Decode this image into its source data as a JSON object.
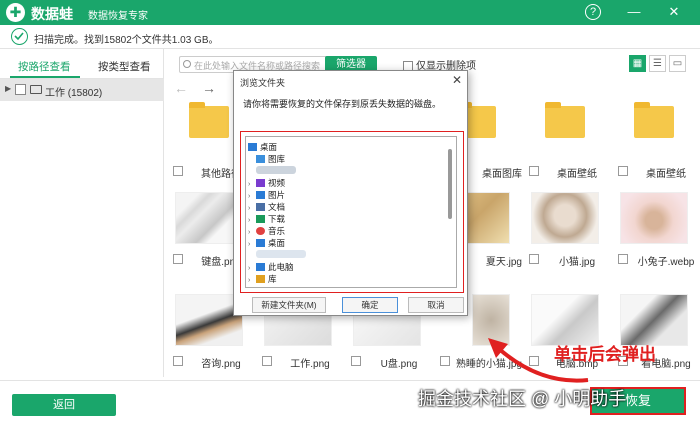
{
  "app": {
    "name": "数据蛙",
    "subtitle": "数据恢复专家"
  },
  "titlebar": {
    "help": "?",
    "minimize": "—",
    "close": "✕"
  },
  "status": {
    "text": "扫描完成。找到15802个文件共1.03 GB。"
  },
  "sidebar": {
    "tabs": [
      {
        "label": "按路径查看"
      },
      {
        "label": "按类型查看"
      }
    ],
    "tree": [
      {
        "label": "工作 (15802)"
      }
    ]
  },
  "toolbar": {
    "search_placeholder": "在此处输入文件名称或路径搜索",
    "filter_label": "筛选器",
    "only_deleted_label": "仅显示删除项"
  },
  "grid": {
    "items": [
      {
        "name": "",
        "kind": "folder"
      },
      {
        "name": "",
        "kind": "folder"
      },
      {
        "name": "",
        "kind": "folder"
      },
      {
        "name": "",
        "kind": "folder"
      },
      {
        "name": "",
        "kind": "folder"
      },
      {
        "name": "",
        "kind": "folder"
      },
      {
        "name": "其他路径",
        "kind": "label"
      },
      {
        "name": "",
        "kind": "label"
      },
      {
        "name": "",
        "kind": "label"
      },
      {
        "name": "桌面图库",
        "kind": "label"
      },
      {
        "name": "桌面壁纸",
        "kind": "label"
      },
      {
        "name": "桌面壁纸",
        "kind": "label"
      },
      {
        "name": "键盘.png",
        "kind": "photo"
      },
      {
        "name": "",
        "kind": "photo"
      },
      {
        "name": "",
        "kind": "photo"
      },
      {
        "name": "夏天.jpg",
        "kind": "photo"
      },
      {
        "name": "小猫.jpg",
        "kind": "photo"
      },
      {
        "name": "小兔子.webp",
        "kind": "photo"
      },
      {
        "name": "咨询.png",
        "kind": "photo"
      },
      {
        "name": "工作.png",
        "kind": "photo"
      },
      {
        "name": "U盘.png",
        "kind": "photo"
      },
      {
        "name": "熟睡的小猫.jpg",
        "kind": "photo"
      },
      {
        "name": "电脑.bmp",
        "kind": "photo"
      },
      {
        "name": "看电脑.png",
        "kind": "photo"
      }
    ]
  },
  "dialog": {
    "title": "浏览文件夹",
    "close": "✕",
    "instruction": "请你将需要恢复的文件保存到原丢失数据的磁盘。",
    "tree": [
      {
        "label": "桌面",
        "icon": "desktop-icon",
        "color": "#2a7bd5"
      },
      {
        "label": "图库",
        "icon": "gallery-icon",
        "color": "#3a8fdc"
      },
      {
        "label": "",
        "icon": "user-icon",
        "color": "#9ab"
      },
      {
        "label": "视频",
        "icon": "video-icon",
        "color": "#7a3ccf"
      },
      {
        "label": "图片",
        "icon": "picture-icon",
        "color": "#2a7bd5"
      },
      {
        "label": "文档",
        "icon": "document-icon",
        "color": "#4a6fa5"
      },
      {
        "label": "下载",
        "icon": "download-icon",
        "color": "#1a9a5a"
      },
      {
        "label": "音乐",
        "icon": "music-icon",
        "color": "#e04040"
      },
      {
        "label": "桌面",
        "icon": "desktop-icon",
        "color": "#2a7bd5"
      },
      {
        "label": "",
        "icon": "blurred-icon",
        "color": "#bcd"
      },
      {
        "label": "此电脑",
        "icon": "computer-icon",
        "color": "#2a7bd5"
      },
      {
        "label": "库",
        "icon": "library-icon",
        "color": "#e0a020"
      }
    ],
    "new_folder": "新建文件夹(M)",
    "ok": "确定",
    "cancel": "取消"
  },
  "bottom": {
    "back": "返回",
    "recover": "恢复"
  },
  "annotation": {
    "text": "单击后会弹出"
  },
  "watermark": {
    "text": "掘金技术社区 @ 小明助手"
  },
  "colors": {
    "accent": "#1aa66b",
    "highlight": "#e02020"
  }
}
